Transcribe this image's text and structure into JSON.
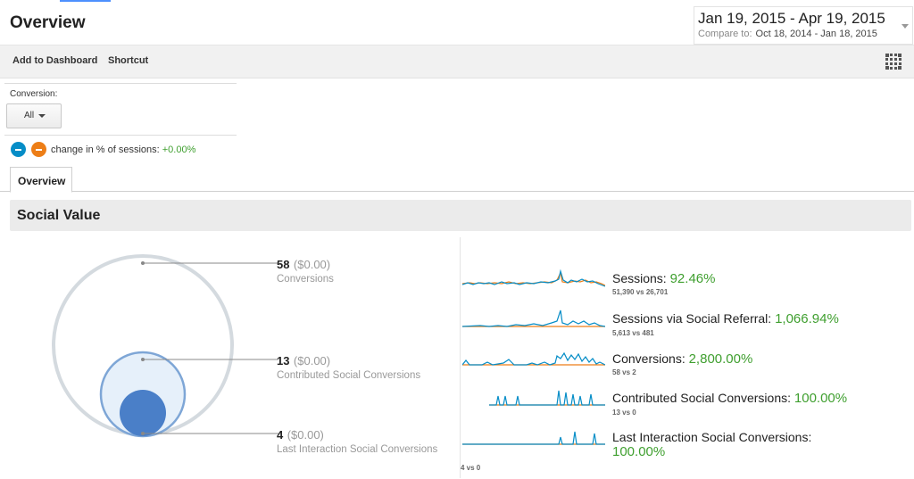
{
  "header": {
    "title": "Overview",
    "date_range": "Jan 19, 2015 - Apr 19, 2015",
    "compare_label": "Compare to:",
    "compare_range": "Oct 18, 2014 - Jan 18, 2015"
  },
  "toolbar": {
    "add_to_dashboard": "Add to Dashboard",
    "shortcut": "Shortcut"
  },
  "filter": {
    "label": "Conversion:",
    "selected": "All"
  },
  "segments": {
    "colors": [
      "#058dc7",
      "#ed7e17"
    ],
    "change_label": "change in % of sessions:",
    "change_value": "+0.00%"
  },
  "tabs": [
    {
      "label": "Overview"
    }
  ],
  "section": {
    "title": "Social Value"
  },
  "circles": [
    {
      "value": "58",
      "money": "($0.00)",
      "label": "Conversions"
    },
    {
      "value": "13",
      "money": "($0.00)",
      "label": "Contributed Social Conversions"
    },
    {
      "value": "4",
      "money": "($0.00)",
      "label": "Last Interaction Social Conversions"
    }
  ],
  "sparklines": [
    {
      "name": "Sessions:",
      "pct": "92.46%",
      "compare": "51,390 vs 26,701"
    },
    {
      "name": "Sessions via Social Referral:",
      "pct": "1,066.94%",
      "compare": "5,613 vs 481"
    },
    {
      "name": "Conversions:",
      "pct": "2,800.00%",
      "compare": "58 vs 2"
    },
    {
      "name": "Contributed Social Conversions:",
      "pct": "100.00%",
      "compare": "13 vs 0"
    },
    {
      "name": "Last Interaction Social Conversions:",
      "pct": "100.00%",
      "compare": "4 vs 0"
    }
  ],
  "colors": {
    "series_primary": "#058dc7",
    "series_compare": "#ed7e17",
    "positive": "#3f9f2f"
  }
}
